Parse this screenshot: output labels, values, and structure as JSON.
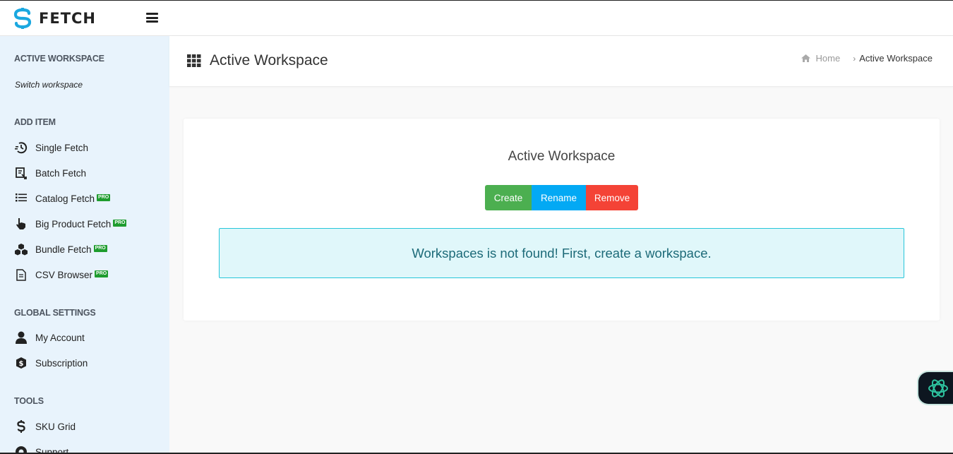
{
  "brand": {
    "name": "FETCH",
    "color": "#1ba8e0"
  },
  "sidebar": {
    "sections": [
      {
        "heading": "ACTIVE WORKSPACE"
      },
      {
        "heading": "ADD ITEM"
      },
      {
        "heading": "GLOBAL SETTINGS"
      },
      {
        "heading": "TOOLS"
      }
    ],
    "switch_workspace": "Switch workspace",
    "add_items": [
      {
        "label": "Single Fetch",
        "icon": "single-fetch-icon",
        "pro": false
      },
      {
        "label": "Batch Fetch",
        "icon": "batch-fetch-icon",
        "pro": false
      },
      {
        "label": "Catalog Fetch",
        "icon": "list-icon",
        "pro": true
      },
      {
        "label": "Big Product Fetch",
        "icon": "hand-pointer-icon",
        "pro": true
      },
      {
        "label": "Bundle Fetch",
        "icon": "cubes-icon",
        "pro": true
      },
      {
        "label": "CSV Browser",
        "icon": "file-icon",
        "pro": true
      }
    ],
    "settings_items": [
      {
        "label": "My Account",
        "icon": "user-icon"
      },
      {
        "label": "Subscription",
        "icon": "subscription-icon"
      }
    ],
    "tools_items": [
      {
        "label": "SKU Grid",
        "icon": "dollar-icon"
      },
      {
        "label": "Support",
        "icon": "support-icon"
      }
    ],
    "pro_badge": "PRO"
  },
  "header": {
    "title": "Active Workspace",
    "breadcrumb": {
      "home": "Home",
      "current": "Active Workspace"
    }
  },
  "card": {
    "title": "Active Workspace",
    "buttons": {
      "create": "Create",
      "rename": "Rename",
      "remove": "Remove"
    },
    "alert": "Workspaces is not found! First, create a workspace."
  },
  "colors": {
    "create": "#4caf50",
    "rename": "#03a9f4",
    "remove": "#f44336",
    "alert_bg": "#e0f7fa",
    "alert_border": "#26c6da",
    "sidebar_bg": "#e8f3fc",
    "pro_badge": "#1e9c2e"
  }
}
